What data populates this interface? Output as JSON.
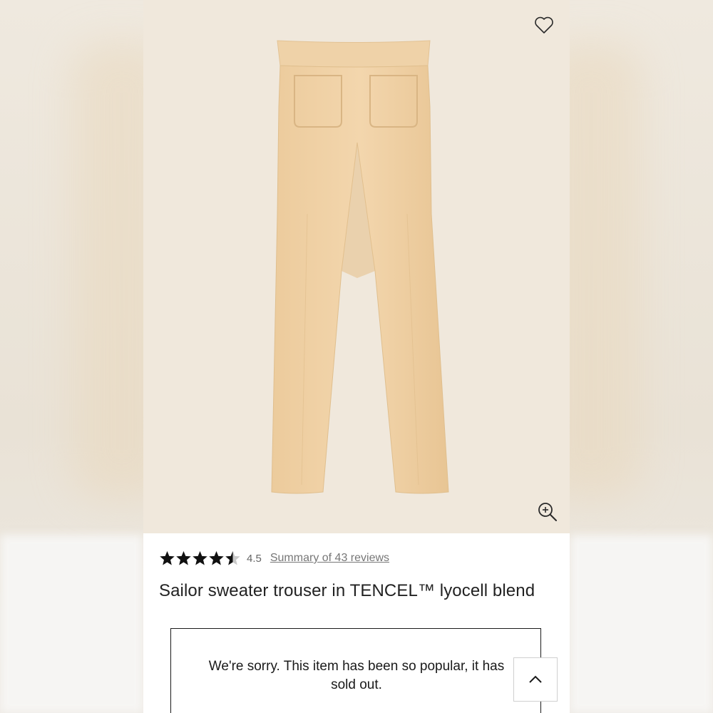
{
  "product": {
    "title": "Sailor sweater trouser in TENCEL™ lyocell blend",
    "rating": "4.5",
    "rating_stars": 4.5,
    "reviews_link": "Summary of 43 reviews",
    "image_alt": "Sailor sweater trouser",
    "image_background": "#f0e8dc",
    "garment_color": "#f1d3a8"
  },
  "icons": {
    "wishlist": "heart-icon",
    "zoom": "zoom-in-icon",
    "scroll_top": "chevron-up-icon",
    "star": "star-icon"
  },
  "notice": {
    "sold_out_message": "We're sorry. This item has been so popular, it has sold out."
  }
}
